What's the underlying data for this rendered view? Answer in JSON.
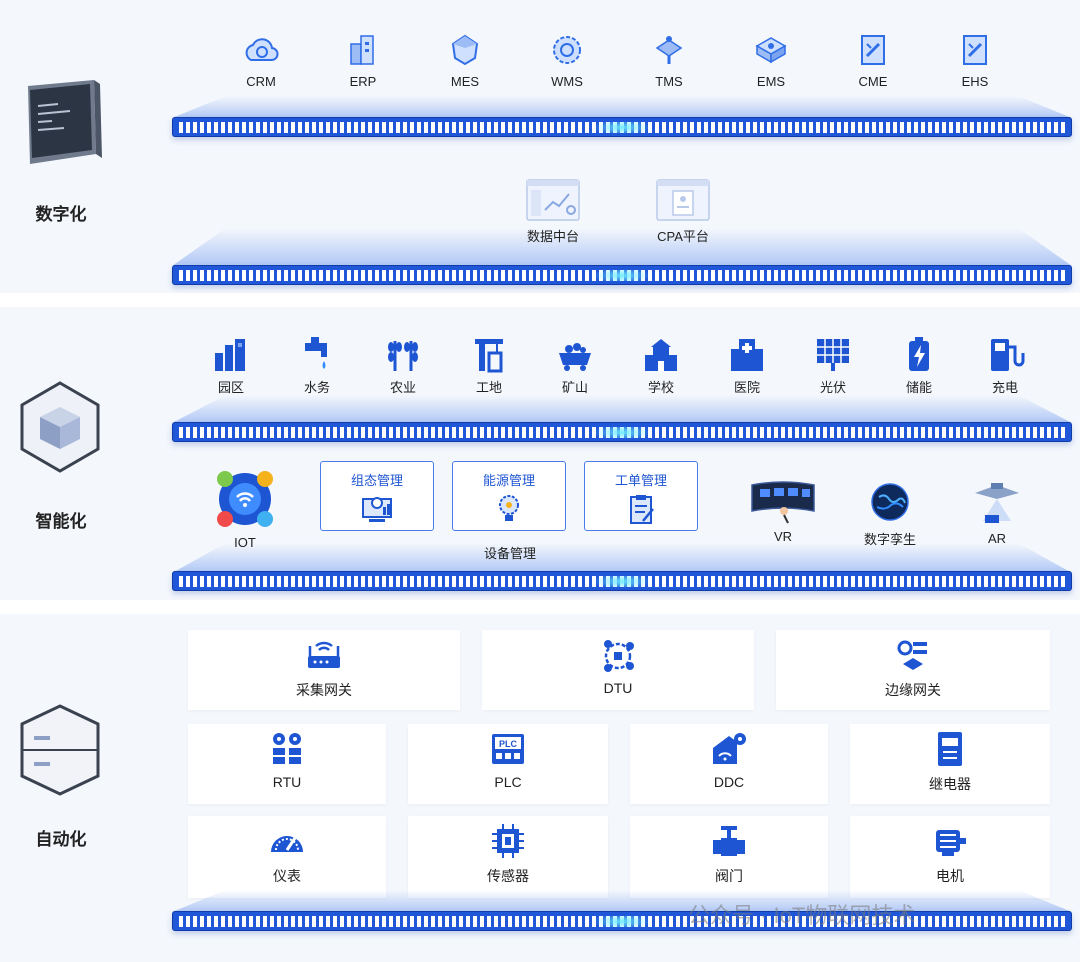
{
  "colors": {
    "accent": "#1e55d3",
    "rail": "#1f57d8",
    "background": "#f4f7fc"
  },
  "digital": {
    "title": "数字化",
    "systems": [
      {
        "label": "CRM",
        "icon": "cloud-gear-icon"
      },
      {
        "label": "ERP",
        "icon": "buildings-icon"
      },
      {
        "label": "MES",
        "icon": "gem-icon"
      },
      {
        "label": "WMS",
        "icon": "gear-badge-icon"
      },
      {
        "label": "TMS",
        "icon": "robot-arm-icon"
      },
      {
        "label": "EMS",
        "icon": "server-icon"
      },
      {
        "label": "CME",
        "icon": "tools-panel-icon"
      },
      {
        "label": "EHS",
        "icon": "tools-panel-icon"
      }
    ],
    "platforms": [
      {
        "label": "数据中台",
        "icon": "dashboard-window-icon"
      },
      {
        "label": "CPA平台",
        "icon": "document-window-icon"
      }
    ]
  },
  "smart": {
    "title": "智能化",
    "scenes": [
      {
        "label": "园区",
        "icon": "park-icon"
      },
      {
        "label": "水务",
        "icon": "faucet-icon"
      },
      {
        "label": "农业",
        "icon": "wheat-icon"
      },
      {
        "label": "工地",
        "icon": "crane-icon"
      },
      {
        "label": "矿山",
        "icon": "mine-cart-icon"
      },
      {
        "label": "学校",
        "icon": "school-icon"
      },
      {
        "label": "医院",
        "icon": "hospital-icon"
      },
      {
        "label": "光伏",
        "icon": "solar-panel-icon"
      },
      {
        "label": "储能",
        "icon": "battery-icon"
      },
      {
        "label": "充电",
        "icon": "charger-icon"
      }
    ],
    "iot": {
      "label": "IOT",
      "icon": "iot-hub-icon"
    },
    "device_management": {
      "label": "设备管理",
      "modules": [
        {
          "label": "组态管理",
          "icon": "monitor-gear-icon"
        },
        {
          "label": "能源管理",
          "icon": "bulb-gear-icon"
        },
        {
          "label": "工单管理",
          "icon": "clipboard-icon"
        }
      ]
    },
    "apps": [
      {
        "label": "VR",
        "icon": "vr-screen-icon"
      },
      {
        "label": "数字孪生",
        "icon": "globe-icon"
      },
      {
        "label": "AR",
        "icon": "drone-icon"
      }
    ]
  },
  "automation": {
    "title": "自动化",
    "gateways": [
      {
        "label": "采集网关",
        "icon": "router-icon"
      },
      {
        "label": "DTU",
        "icon": "network-node-icon"
      },
      {
        "label": "边缘网关",
        "icon": "edge-gateway-icon"
      }
    ],
    "devices_row1": [
      {
        "label": "RTU",
        "icon": "rtu-icon"
      },
      {
        "label": "PLC",
        "icon": "plc-icon"
      },
      {
        "label": "DDC",
        "icon": "ddc-icon"
      },
      {
        "label": "继电器",
        "icon": "relay-icon"
      }
    ],
    "devices_row2": [
      {
        "label": "仪表",
        "icon": "gauge-icon"
      },
      {
        "label": "传感器",
        "icon": "chip-icon"
      },
      {
        "label": "阀门",
        "icon": "valve-icon"
      },
      {
        "label": "电机",
        "icon": "motor-icon"
      }
    ]
  },
  "watermark": "公众号 · IoT物联网技术"
}
